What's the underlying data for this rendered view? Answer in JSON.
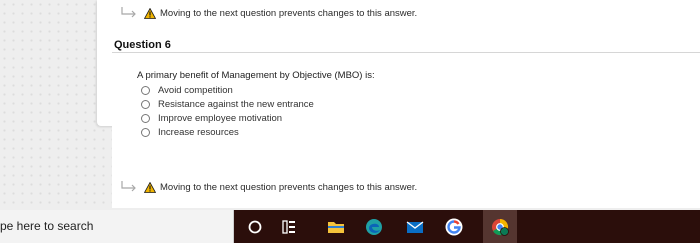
{
  "warning_text": "Moving to the next question prevents changes to this answer.",
  "question": {
    "title": "Question 6",
    "prompt": "A primary benefit of Management by Objective (MBO) is:",
    "options": [
      "Avoid competition",
      "Resistance against the new entrance",
      "Improve employee motivation",
      "Increase resources"
    ]
  },
  "taskbar": {
    "search_text": "pe here to search",
    "icons": [
      "cortana-icon",
      "task-view-icon",
      "file-explorer-icon",
      "edge-icon",
      "mail-icon",
      "google-chrome-icon",
      "chrome-profile-icon"
    ]
  },
  "colors": {
    "warning": "#f0b400",
    "taskbar": "#2b0e0b",
    "accent": "#0078d7"
  }
}
